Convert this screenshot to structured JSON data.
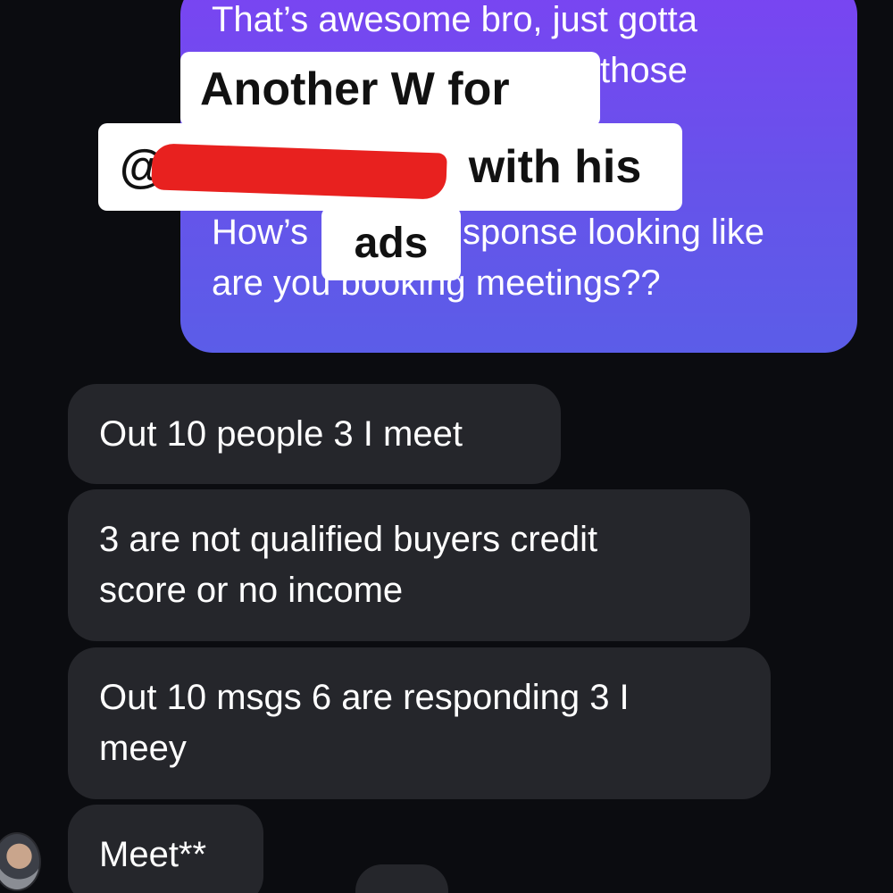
{
  "sent_message": {
    "lines": [
      "That’s awesome bro, just gotta",
      "those",
      "",
      "How’s",
      "sponse looking like",
      "are you booking meetings??"
    ],
    "color_top": "#7a44f2",
    "color_bottom": "#5b5de8"
  },
  "received_messages": [
    {
      "lines": [
        "Out 10 people 3 I meet"
      ]
    },
    {
      "lines": [
        "3 are not qualified buyers credit",
        "score or no income"
      ]
    },
    {
      "lines": [
        "Out 10 msgs 6 are responding 3 I",
        "meey"
      ]
    },
    {
      "lines": [
        "Meet**"
      ]
    }
  ],
  "overlay_caption": {
    "line1": "Another W for",
    "line2_prefix": "@",
    "line2_suffix": "with his",
    "line3": "ads"
  },
  "colors": {
    "background": "#0b0c10",
    "received_bubble": "#25262b",
    "redaction": "#e8211f"
  }
}
